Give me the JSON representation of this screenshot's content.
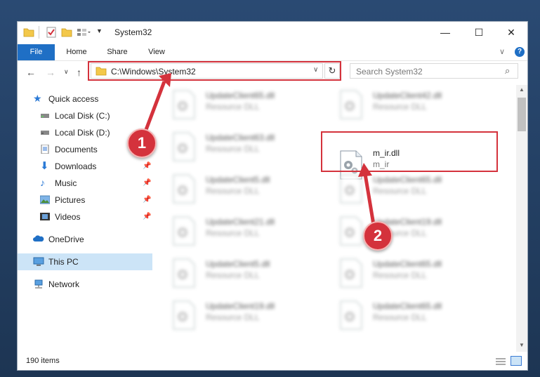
{
  "window": {
    "title": "System32",
    "controls": {
      "minimize": "—",
      "maximize": "☐",
      "close": "✕"
    }
  },
  "ribbon": {
    "tabs": [
      {
        "label": "File"
      },
      {
        "label": "Home"
      },
      {
        "label": "Share"
      },
      {
        "label": "View"
      }
    ],
    "help_icon": "?"
  },
  "address_bar": {
    "path": "C:\\Windows\\System32"
  },
  "search": {
    "placeholder": "Search System32"
  },
  "navigation": {
    "items": [
      {
        "label": "Quick access",
        "icon": "star-icon",
        "pinned": false
      },
      {
        "label": "Local Disk (C:)",
        "icon": "drive-icon",
        "pinned": false
      },
      {
        "label": "Local Disk (D:)",
        "icon": "drive-icon",
        "pinned": false
      },
      {
        "label": "Documents",
        "icon": "documents-icon",
        "pinned": true
      },
      {
        "label": "Downloads",
        "icon": "download-icon",
        "pinned": true
      },
      {
        "label": "Music",
        "icon": "music-icon",
        "pinned": true
      },
      {
        "label": "Pictures",
        "icon": "pictures-icon",
        "pinned": true
      },
      {
        "label": "Videos",
        "icon": "videos-icon",
        "pinned": true
      },
      {
        "label": "OneDrive",
        "icon": "cloud-icon",
        "pinned": false
      },
      {
        "label": "This PC",
        "icon": "computer-icon",
        "pinned": false,
        "selected": true
      },
      {
        "label": "Network",
        "icon": "network-icon",
        "pinned": false
      }
    ]
  },
  "files": [
    {
      "name": "UpdateClient65.dll",
      "type": "Resource DLL"
    },
    {
      "name": "UpdateClient42.dll",
      "type": "Resource DLL"
    },
    {
      "name": "UpdateClient63.dll",
      "type": "Resource DLL"
    },
    {
      "name": "m_ir.dll",
      "type": "m_ir"
    },
    {
      "name": "UpdateClient5.dll",
      "type": "Resource DLL"
    },
    {
      "name": "UpdateClient65.dll",
      "type": "Resource DLL"
    },
    {
      "name": "UpdateClient21.dll",
      "type": "Resource DLL"
    },
    {
      "name": "UpdateClient19.dll",
      "type": "Resource DLL"
    },
    {
      "name": "UpdateClient5.dll",
      "type": "Resource DLL"
    },
    {
      "name": "UpdateClient65.dll",
      "type": "Resource DLL"
    },
    {
      "name": "UpdateClient19.dll",
      "type": "Resource DLL"
    },
    {
      "name": "UpdateClient65.dll",
      "type": "Resource DLL"
    }
  ],
  "status": {
    "item_count": "190 items"
  },
  "callouts": [
    {
      "label": "1"
    },
    {
      "label": "2"
    }
  ],
  "colors": {
    "accent": "#1f6fc5",
    "highlight_red": "#d4323c",
    "selected_nav": "#cce4f7"
  }
}
